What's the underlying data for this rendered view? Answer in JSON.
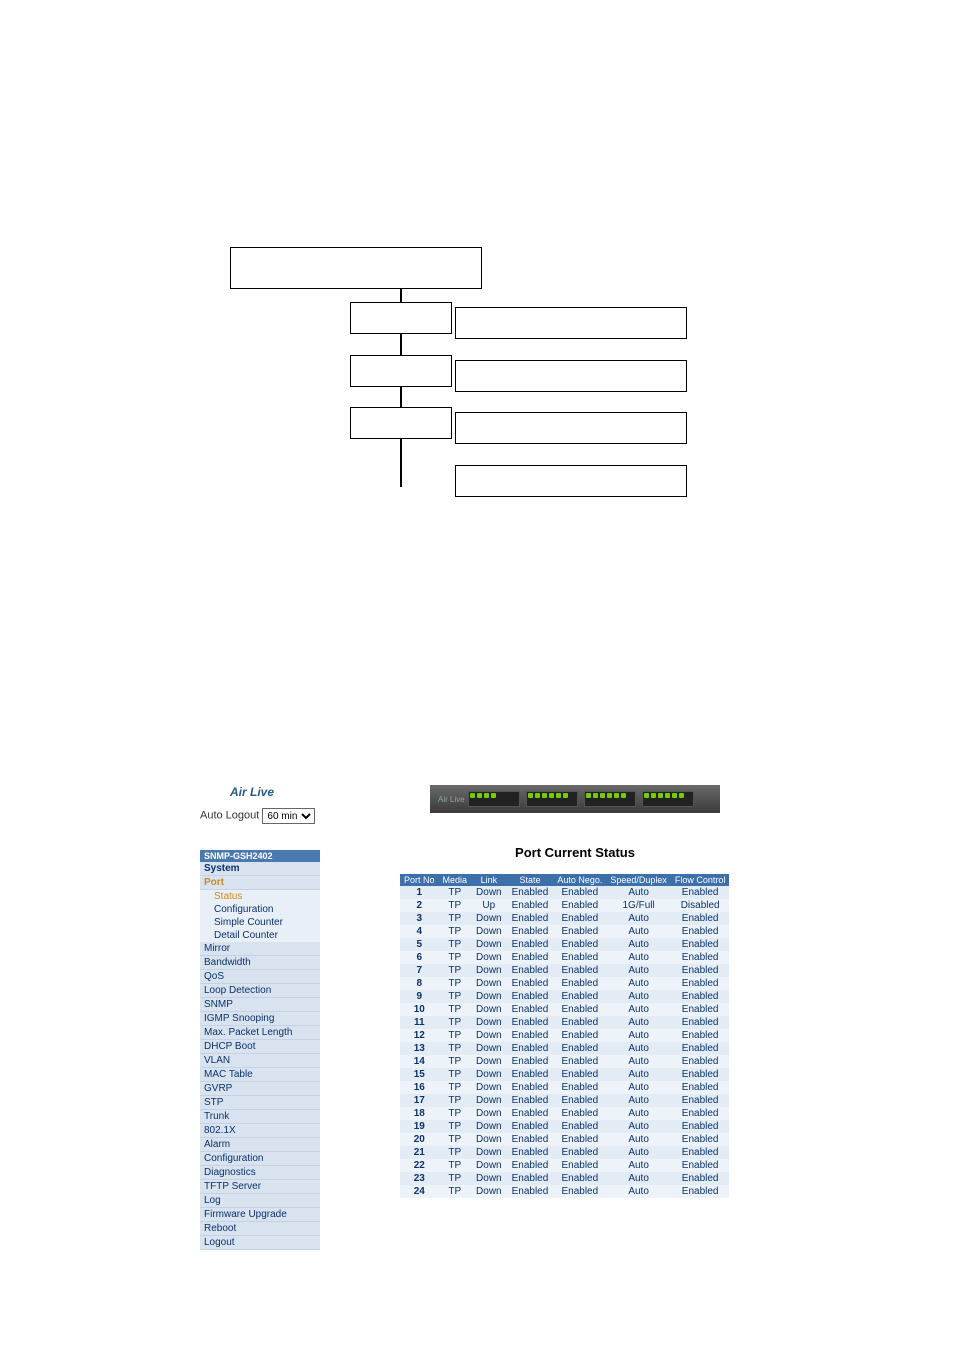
{
  "auto_logout_label": "Auto Logout",
  "auto_logout_value": "60 min",
  "logo_text": "Air Live",
  "sidebar_title": "SNMP-GSH2402",
  "sidebar": [
    {
      "label": "System",
      "cls": "side-item top"
    },
    {
      "label": "Port",
      "cls": "side-item port"
    },
    {
      "label": "Status",
      "cls": "side-sub sel"
    },
    {
      "label": "Configuration",
      "cls": "side-sub"
    },
    {
      "label": "Simple Counter",
      "cls": "side-sub"
    },
    {
      "label": "Detail Counter",
      "cls": "side-sub"
    },
    {
      "label": "Mirror",
      "cls": "side-item"
    },
    {
      "label": "Bandwidth",
      "cls": "side-item"
    },
    {
      "label": "QoS",
      "cls": "side-item"
    },
    {
      "label": "Loop Detection",
      "cls": "side-item"
    },
    {
      "label": "SNMP",
      "cls": "side-item"
    },
    {
      "label": "IGMP Snooping",
      "cls": "side-item"
    },
    {
      "label": "Max. Packet Length",
      "cls": "side-item"
    },
    {
      "label": "DHCP Boot",
      "cls": "side-item"
    },
    {
      "label": "VLAN",
      "cls": "side-item"
    },
    {
      "label": "MAC Table",
      "cls": "side-item"
    },
    {
      "label": "GVRP",
      "cls": "side-item"
    },
    {
      "label": "STP",
      "cls": "side-item"
    },
    {
      "label": "Trunk",
      "cls": "side-item"
    },
    {
      "label": "802.1X",
      "cls": "side-item"
    },
    {
      "label": "Alarm",
      "cls": "side-item"
    },
    {
      "label": "Configuration",
      "cls": "side-item"
    },
    {
      "label": "Diagnostics",
      "cls": "side-item"
    },
    {
      "label": "TFTP Server",
      "cls": "side-item"
    },
    {
      "label": "Log",
      "cls": "side-item"
    },
    {
      "label": "Firmware Upgrade",
      "cls": "side-item"
    },
    {
      "label": "Reboot",
      "cls": "side-item"
    },
    {
      "label": "Logout",
      "cls": "side-item"
    }
  ],
  "table_title": "Port Current Status",
  "headers": [
    "Port No",
    "Media",
    "Link",
    "State",
    "Auto Nego.",
    "Speed/Duplex",
    "Flow Control"
  ],
  "rows": [
    {
      "port": "1",
      "media": "TP",
      "link": "Down",
      "state": "Enabled",
      "nego": "Enabled",
      "spd": "Auto",
      "flow": "Enabled"
    },
    {
      "port": "2",
      "media": "TP",
      "link": "Up",
      "state": "Enabled",
      "nego": "Enabled",
      "spd": "1G/Full",
      "flow": "Disabled"
    },
    {
      "port": "3",
      "media": "TP",
      "link": "Down",
      "state": "Enabled",
      "nego": "Enabled",
      "spd": "Auto",
      "flow": "Enabled"
    },
    {
      "port": "4",
      "media": "TP",
      "link": "Down",
      "state": "Enabled",
      "nego": "Enabled",
      "spd": "Auto",
      "flow": "Enabled"
    },
    {
      "port": "5",
      "media": "TP",
      "link": "Down",
      "state": "Enabled",
      "nego": "Enabled",
      "spd": "Auto",
      "flow": "Enabled"
    },
    {
      "port": "6",
      "media": "TP",
      "link": "Down",
      "state": "Enabled",
      "nego": "Enabled",
      "spd": "Auto",
      "flow": "Enabled"
    },
    {
      "port": "7",
      "media": "TP",
      "link": "Down",
      "state": "Enabled",
      "nego": "Enabled",
      "spd": "Auto",
      "flow": "Enabled"
    },
    {
      "port": "8",
      "media": "TP",
      "link": "Down",
      "state": "Enabled",
      "nego": "Enabled",
      "spd": "Auto",
      "flow": "Enabled"
    },
    {
      "port": "9",
      "media": "TP",
      "link": "Down",
      "state": "Enabled",
      "nego": "Enabled",
      "spd": "Auto",
      "flow": "Enabled"
    },
    {
      "port": "10",
      "media": "TP",
      "link": "Down",
      "state": "Enabled",
      "nego": "Enabled",
      "spd": "Auto",
      "flow": "Enabled"
    },
    {
      "port": "11",
      "media": "TP",
      "link": "Down",
      "state": "Enabled",
      "nego": "Enabled",
      "spd": "Auto",
      "flow": "Enabled"
    },
    {
      "port": "12",
      "media": "TP",
      "link": "Down",
      "state": "Enabled",
      "nego": "Enabled",
      "spd": "Auto",
      "flow": "Enabled"
    },
    {
      "port": "13",
      "media": "TP",
      "link": "Down",
      "state": "Enabled",
      "nego": "Enabled",
      "spd": "Auto",
      "flow": "Enabled"
    },
    {
      "port": "14",
      "media": "TP",
      "link": "Down",
      "state": "Enabled",
      "nego": "Enabled",
      "spd": "Auto",
      "flow": "Enabled"
    },
    {
      "port": "15",
      "media": "TP",
      "link": "Down",
      "state": "Enabled",
      "nego": "Enabled",
      "spd": "Auto",
      "flow": "Enabled"
    },
    {
      "port": "16",
      "media": "TP",
      "link": "Down",
      "state": "Enabled",
      "nego": "Enabled",
      "spd": "Auto",
      "flow": "Enabled"
    },
    {
      "port": "17",
      "media": "TP",
      "link": "Down",
      "state": "Enabled",
      "nego": "Enabled",
      "spd": "Auto",
      "flow": "Enabled"
    },
    {
      "port": "18",
      "media": "TP",
      "link": "Down",
      "state": "Enabled",
      "nego": "Enabled",
      "spd": "Auto",
      "flow": "Enabled"
    },
    {
      "port": "19",
      "media": "TP",
      "link": "Down",
      "state": "Enabled",
      "nego": "Enabled",
      "spd": "Auto",
      "flow": "Enabled"
    },
    {
      "port": "20",
      "media": "TP",
      "link": "Down",
      "state": "Enabled",
      "nego": "Enabled",
      "spd": "Auto",
      "flow": "Enabled"
    },
    {
      "port": "21",
      "media": "TP",
      "link": "Down",
      "state": "Enabled",
      "nego": "Enabled",
      "spd": "Auto",
      "flow": "Enabled"
    },
    {
      "port": "22",
      "media": "TP",
      "link": "Down",
      "state": "Enabled",
      "nego": "Enabled",
      "spd": "Auto",
      "flow": "Enabled"
    },
    {
      "port": "23",
      "media": "TP",
      "link": "Down",
      "state": "Enabled",
      "nego": "Enabled",
      "spd": "Auto",
      "flow": "Enabled"
    },
    {
      "port": "24",
      "media": "TP",
      "link": "Down",
      "state": "Enabled",
      "nego": "Enabled",
      "spd": "Auto",
      "flow": "Enabled"
    }
  ]
}
